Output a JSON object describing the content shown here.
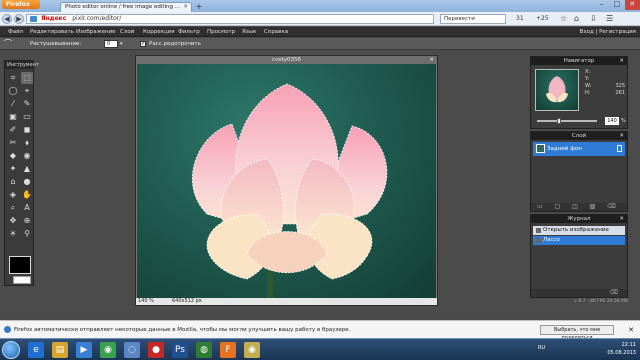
{
  "browser": {
    "app_button": "Firefox",
    "tab_title": "Photo editor online / free image editing ...",
    "new_tab": "+",
    "url": "pixlr.com/editor/",
    "search_brand": "Яндекс",
    "translate": "Перевести",
    "counter1": "31",
    "counter2": "+25",
    "win_min": "–",
    "win_max": "□",
    "win_close": "✕",
    "nav_back": "◀",
    "nav_forward": "▶"
  },
  "menu": {
    "items": [
      "Файл",
      "Редактировать",
      "Изображение",
      "Слой",
      "Коррекция",
      "Фильтр",
      "Просмотр",
      "Язык",
      "Справка"
    ],
    "login": "Вход",
    "separator": "|",
    "register": "Регистрация"
  },
  "options": {
    "feather_label": "Растушевывание:",
    "feather_value": "0",
    "antialias_label": "Расс.редотрочить",
    "antialias_check": "✓"
  },
  "tools": {
    "title": "Инструмент",
    "icons": [
      "⌗",
      "⬚",
      "◯",
      "⌖",
      "⁄",
      "✎",
      "▣",
      "▭",
      "✐",
      "◼",
      "✂",
      "⬧",
      "◆",
      "◉",
      "✦",
      "▲",
      "⌂",
      "●",
      "◈",
      "✋",
      "⌕",
      "A",
      "✥",
      "⊕",
      "☀",
      "⚲"
    ]
  },
  "document": {
    "title": "cvety0356",
    "close": "✕",
    "zoom": "140 %",
    "size": "640x512 px"
  },
  "navigator": {
    "title": "Навигатор",
    "x_label": "X:",
    "x_val": "",
    "y_label": "Y:",
    "y_val": "",
    "w_label": "W:",
    "w_val": "325",
    "h_label": "H:",
    "h_val": "261",
    "zoom": "140",
    "pct": "%",
    "zoom_level": 0.35
  },
  "layers": {
    "title": "Слой",
    "row": "Задний фон",
    "footer": "▭ ▢ ◫ ▧ ⌫"
  },
  "history": {
    "title": "Журнал",
    "rows": [
      "Открыть изображение",
      "Лассо"
    ],
    "footer": "⌫"
  },
  "status": {
    "version": "v 8.7 - 80 FPS 29.58 MB"
  },
  "notification": {
    "text": "Firefox автоматически отправляет некоторые данные в Mozilla, чтобы мы могли улучшить вашу работу в браузере.",
    "button": "Выбрать, что мне поделиться",
    "close": "✕"
  },
  "taskbar": {
    "lang": "RU",
    "time": "22:11",
    "date": "05.08.2013",
    "apps": [
      "e",
      "▤",
      "▶",
      "◉",
      "◌",
      "●",
      "Ps",
      "◍",
      "F",
      "◉"
    ]
  },
  "colors": {
    "selection_blue": "#2f7bd6",
    "canvas_green": "#205c50",
    "lotus_pink": "#f4a9b8"
  }
}
